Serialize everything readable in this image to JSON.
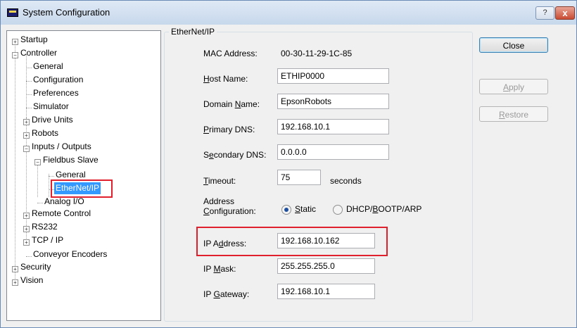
{
  "window": {
    "title": "System Configuration",
    "help_label": "?",
    "close_label": "x"
  },
  "tree": {
    "startup": "Startup",
    "controller": "Controller",
    "general": "General",
    "configuration": "Configuration",
    "preferences": "Preferences",
    "simulator": "Simulator",
    "drive_units": "Drive Units",
    "robots": "Robots",
    "inputs_outputs": "Inputs / Outputs",
    "fieldbus_slave": "Fieldbus Slave",
    "fb_general": "General",
    "ethernet_ip": "EtherNet/IP",
    "analog_io": "Analog I/O",
    "remote_control": "Remote Control",
    "rs232": "RS232",
    "tcp_ip": "TCP / IP",
    "conveyor_encoders": "Conveyor Encoders",
    "security": "Security",
    "vision": "Vision"
  },
  "form": {
    "group_title": "EtherNet/IP",
    "mac_label": "MAC Address:",
    "mac_value": "00-30-11-29-1C-85",
    "host_label_u": "H",
    "host_label_rest": "ost Name:",
    "host_value": "ETHIP0000",
    "domain_label_a": "Domain ",
    "domain_label_u": "N",
    "domain_label_b": "ame:",
    "domain_value": "EpsonRobots",
    "pdns_label_u": "P",
    "pdns_label_rest": "rimary DNS:",
    "pdns_value": "192.168.10.1",
    "sdns_label_a": "S",
    "sdns_label_u": "e",
    "sdns_label_b": "condary DNS:",
    "sdns_value": "0.0.0.0",
    "timeout_label_u": "T",
    "timeout_label_rest": "imeout:",
    "timeout_value": "75",
    "timeout_unit": "seconds",
    "addr_label_1": "Address",
    "addr_label_2_u": "C",
    "addr_label_2_rest": "onfiguration:",
    "static_u": "S",
    "static_rest": "tatic",
    "dhcp_a": "DHCP/",
    "dhcp_u": "B",
    "dhcp_b": "OOTP/ARP",
    "ip_label_a": "IP A",
    "ip_label_u": "d",
    "ip_label_b": "dress:",
    "ip_value": "192.168.10.162",
    "mask_label_a": "IP ",
    "mask_label_u": "M",
    "mask_label_b": "ask:",
    "mask_value": "255.255.255.0",
    "gw_label_a": "IP ",
    "gw_label_u": "G",
    "gw_label_b": "ateway:",
    "gw_value": "192.168.10.1"
  },
  "buttons": {
    "close": "Close",
    "apply_u": "A",
    "apply_rest": "pply",
    "restore_u": "R",
    "restore_rest": "estore"
  },
  "colors": {
    "selection": "#3399ff",
    "highlight_box": "#e0202c"
  }
}
